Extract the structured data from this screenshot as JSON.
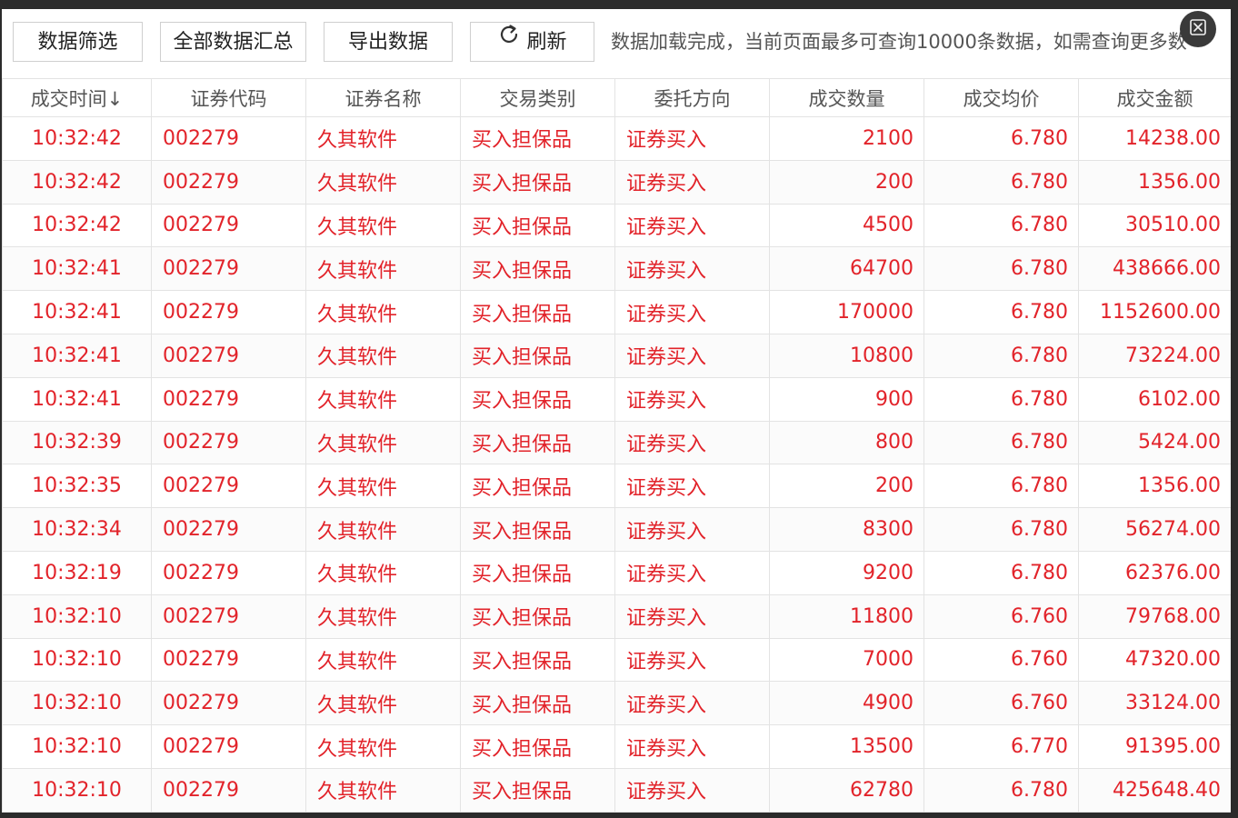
{
  "toolbar": {
    "filter_label": "数据筛选",
    "summary_label": "全部数据汇总",
    "export_label": "导出数据",
    "refresh_label": "刷新",
    "status_text": "数据加载完成，当前页面最多可查询10000条数据，如需查询更多数"
  },
  "table": {
    "headers": [
      "成交时间↓",
      "证券代码",
      "证券名称",
      "交易类别",
      "委托方向",
      "成交数量",
      "成交均价",
      "成交金额"
    ],
    "rows": [
      [
        "10:32:42",
        "002279",
        "久其软件",
        "买入担保品",
        "证券买入",
        "2100",
        "6.780",
        "14238.00"
      ],
      [
        "10:32:42",
        "002279",
        "久其软件",
        "买入担保品",
        "证券买入",
        "200",
        "6.780",
        "1356.00"
      ],
      [
        "10:32:42",
        "002279",
        "久其软件",
        "买入担保品",
        "证券买入",
        "4500",
        "6.780",
        "30510.00"
      ],
      [
        "10:32:41",
        "002279",
        "久其软件",
        "买入担保品",
        "证券买入",
        "64700",
        "6.780",
        "438666.00"
      ],
      [
        "10:32:41",
        "002279",
        "久其软件",
        "买入担保品",
        "证券买入",
        "170000",
        "6.780",
        "1152600.00"
      ],
      [
        "10:32:41",
        "002279",
        "久其软件",
        "买入担保品",
        "证券买入",
        "10800",
        "6.780",
        "73224.00"
      ],
      [
        "10:32:41",
        "002279",
        "久其软件",
        "买入担保品",
        "证券买入",
        "900",
        "6.780",
        "6102.00"
      ],
      [
        "10:32:39",
        "002279",
        "久其软件",
        "买入担保品",
        "证券买入",
        "800",
        "6.780",
        "5424.00"
      ],
      [
        "10:32:35",
        "002279",
        "久其软件",
        "买入担保品",
        "证券买入",
        "200",
        "6.780",
        "1356.00"
      ],
      [
        "10:32:34",
        "002279",
        "久其软件",
        "买入担保品",
        "证券买入",
        "8300",
        "6.780",
        "56274.00"
      ],
      [
        "10:32:19",
        "002279",
        "久其软件",
        "买入担保品",
        "证券买入",
        "9200",
        "6.780",
        "62376.00"
      ],
      [
        "10:32:10",
        "002279",
        "久其软件",
        "买入担保品",
        "证券买入",
        "11800",
        "6.760",
        "79768.00"
      ],
      [
        "10:32:10",
        "002279",
        "久其软件",
        "买入担保品",
        "证券买入",
        "7000",
        "6.760",
        "47320.00"
      ],
      [
        "10:32:10",
        "002279",
        "久其软件",
        "买入担保品",
        "证券买入",
        "4900",
        "6.760",
        "33124.00"
      ],
      [
        "10:32:10",
        "002279",
        "久其软件",
        "买入担保品",
        "证券买入",
        "13500",
        "6.770",
        "91395.00"
      ],
      [
        "10:32:10",
        "002279",
        "久其软件",
        "买入担保品",
        "证券买入",
        "62780",
        "6.780",
        "425648.40"
      ]
    ]
  },
  "colors": {
    "row_text": "#e2232a",
    "header_text": "#555555",
    "border": "#e3e3e3"
  },
  "icons": {
    "refresh": "refresh-icon",
    "close": "close-icon"
  }
}
